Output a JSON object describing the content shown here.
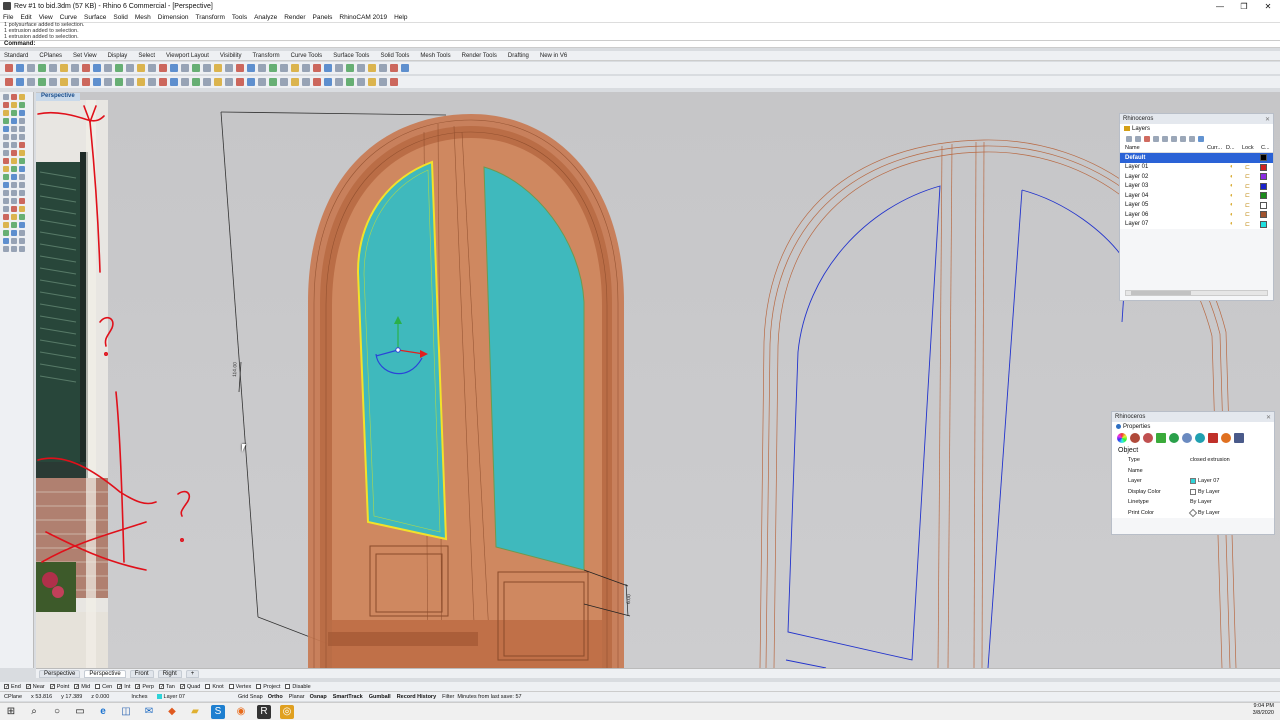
{
  "window": {
    "title": "Rev #1 to bid.3dm (57 KB) - Rhino 6 Commercial - [Perspective]",
    "controls": [
      "—",
      "❐",
      "✕"
    ]
  },
  "menu": [
    "File",
    "Edit",
    "View",
    "Curve",
    "Surface",
    "Solid",
    "Mesh",
    "Dimension",
    "Transform",
    "Tools",
    "Analyze",
    "Render",
    "Panels",
    "RhinoCAM 2019",
    "Help"
  ],
  "command_history": [
    "1 polysurface added to selection.",
    "1 extrusion added to selection.",
    "1 extrusion added to selection."
  ],
  "command": {
    "label": "Command:",
    "value": ""
  },
  "toolbar_tabs": [
    "Standard",
    "CPlanes",
    "Set View",
    "Display",
    "Select",
    "Viewport Layout",
    "Visibility",
    "Transform",
    "Curve Tools",
    "Surface Tools",
    "Solid Tools",
    "Mesh Tools",
    "Render Tools",
    "Drafting",
    "New in V6"
  ],
  "viewport": {
    "label": "Perspective"
  },
  "viewport_tabs": [
    {
      "label": "Perspective"
    },
    {
      "label": "Perspective",
      "active": true
    },
    {
      "label": "Front"
    },
    {
      "label": "Right"
    },
    {
      "label": "+"
    }
  ],
  "dimensions": {
    "height": "114.00",
    "depth": "6.00"
  },
  "layers_panel": {
    "window": "Rhinoceros",
    "tab": "Layers",
    "headers": {
      "name": "Name",
      "current": "Curr...",
      "d": "D...",
      "lock": "Lock",
      "color": "C..."
    },
    "rows": [
      {
        "name": "Default",
        "color": "#000000",
        "selected": true
      },
      {
        "name": "Layer 01",
        "color": "#d02020"
      },
      {
        "name": "Layer 02",
        "color": "#8a2be2"
      },
      {
        "name": "Layer 03",
        "color": "#1a22cc"
      },
      {
        "name": "Layer 04",
        "color": "#1a8a1a"
      },
      {
        "name": "Layer 05",
        "color": "#ffffff"
      },
      {
        "name": "Layer 06",
        "color": "#a0522d"
      },
      {
        "name": "Layer 07",
        "color": "#20e0e0"
      }
    ]
  },
  "properties_panel": {
    "window": "Rhinoceros",
    "tab": "Properties",
    "section": "Object",
    "rows": [
      {
        "key": "Type",
        "value": "closed extrusion"
      },
      {
        "key": "Name",
        "value": ""
      },
      {
        "key": "Layer",
        "value": "Layer 07",
        "swatch": "#2ed3d8"
      },
      {
        "key": "Display Color",
        "value": "By Layer",
        "swatch": "#ffffff"
      },
      {
        "key": "Linetype",
        "value": "By Layer"
      },
      {
        "key": "Print Color",
        "value": "By Layer",
        "swatch": "diamond"
      }
    ]
  },
  "osnaps": [
    {
      "label": "End",
      "checked": true
    },
    {
      "label": "Near",
      "checked": true
    },
    {
      "label": "Point",
      "checked": true
    },
    {
      "label": "Mid",
      "checked": true
    },
    {
      "label": "Cen",
      "checked": false
    },
    {
      "label": "Int",
      "checked": true
    },
    {
      "label": "Perp",
      "checked": true
    },
    {
      "label": "Tan",
      "checked": true
    },
    {
      "label": "Quad",
      "checked": true
    },
    {
      "label": "Knot",
      "checked": false
    },
    {
      "label": "Vertex",
      "checked": false
    },
    {
      "label": "Project",
      "checked": false
    },
    {
      "label": "Disable",
      "checked": false
    }
  ],
  "status": {
    "cplane": "CPlane",
    "x": "x 53.816",
    "y": "y 17.389",
    "z": "z 0.000",
    "units": "Inches",
    "layer": "Layer 07",
    "toggles": [
      "Grid Snap",
      "Ortho",
      "Planar",
      "Osnap",
      "SmartTrack",
      "Gumball",
      "Record History",
      "Filter"
    ],
    "message": "Minutes from last save: 57"
  },
  "clock": {
    "time": "9:04 PM",
    "date": "3/8/2020"
  },
  "colors": {
    "glass": "#3fb9bd",
    "frame": "#c87a4f",
    "selection": "#f2e12a",
    "sketch": "#e0101a",
    "wire_blue": "#2233cc"
  }
}
